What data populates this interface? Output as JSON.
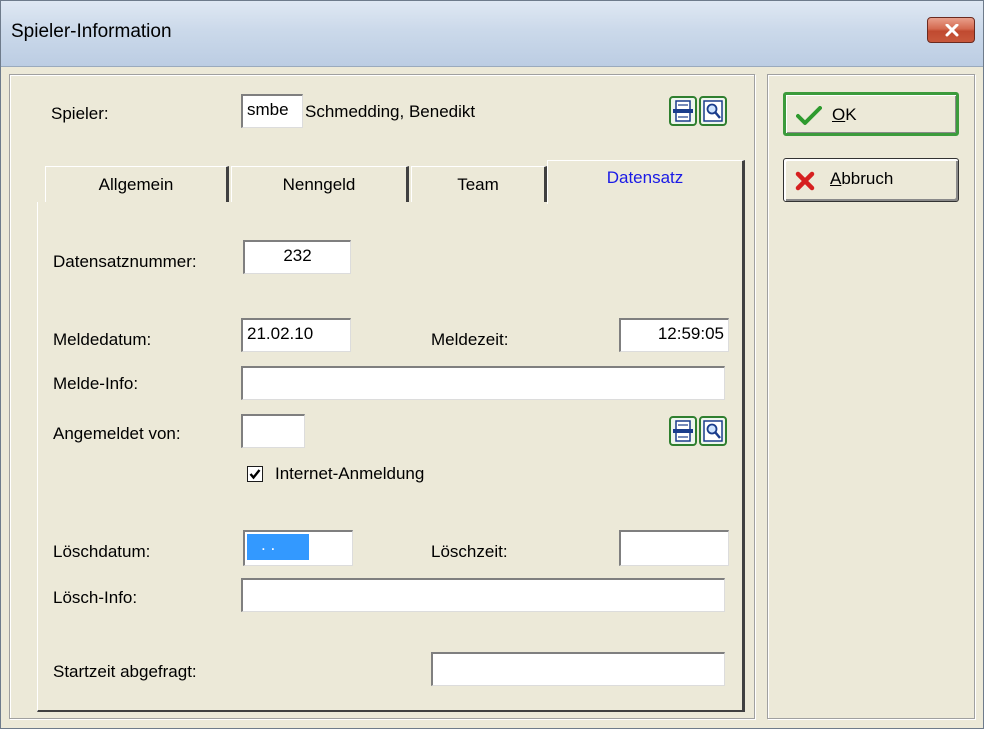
{
  "window": {
    "title": "Spieler-Information"
  },
  "player": {
    "label": "Spieler:",
    "code": "smbe",
    "name": "Schmedding, Benedikt"
  },
  "tabs": [
    {
      "label": "Allgemein"
    },
    {
      "label": "Nenngeld"
    },
    {
      "label": "Team"
    },
    {
      "label": "Datensatz",
      "active": true
    }
  ],
  "record": {
    "number_label": "Datensatznummer:",
    "number_value": "232",
    "reg_date_label": "Meldedatum:",
    "reg_date_value": "21.02.10",
    "reg_time_label": "Meldezeit:",
    "reg_time_value": "12:59:05",
    "reg_info_label": "Melde-Info:",
    "reg_info_value": "",
    "registered_by_label": "Angemeldet von:",
    "registered_by_value": "",
    "internet_label": "Internet-Anmeldung",
    "internet_checked": true,
    "del_date_label": "Löschdatum:",
    "del_date_value": ". .",
    "del_time_label": "Löschzeit:",
    "del_time_value": "",
    "del_info_label": "Lösch-Info:",
    "del_info_value": "",
    "start_query_label": "Startzeit abgefragt:",
    "start_query_value": ""
  },
  "buttons": {
    "ok_mnemonic": "O",
    "ok_rest": "K",
    "cancel_mnemonic": "A",
    "cancel_rest": "bbruch"
  },
  "colors": {
    "active_tab": "#1a1ae6",
    "ok_border": "#3c9b3c",
    "ok_check": "#2e9a2e",
    "cancel_x": "#d62020",
    "selection": "#3399ff"
  }
}
